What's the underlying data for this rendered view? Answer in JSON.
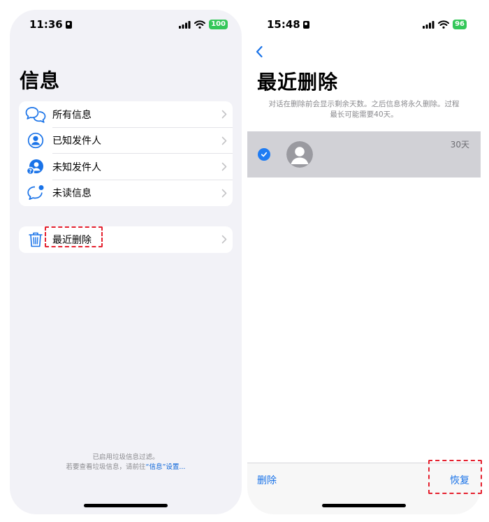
{
  "left_screen": {
    "status": {
      "time": "11:36",
      "battery": "100"
    },
    "title": "信息",
    "filters": [
      {
        "label": "所有信息"
      },
      {
        "label": "已知发件人"
      },
      {
        "label": "未知发件人"
      },
      {
        "label": "未读信息"
      }
    ],
    "recently_deleted": {
      "label": "最近删除"
    },
    "footnote": {
      "line1": "已启用垃圾信息过滤。",
      "line2_prefix": "若要查看垃圾信息，请前往",
      "line2_link": "“信息”设置...",
      "line2_suffix": ""
    }
  },
  "right_screen": {
    "status": {
      "time": "15:48",
      "battery": "96"
    },
    "title": "最近删除",
    "subtitle_line1": "对话在删除前会显示剩余天数。之后信息将永久删除。过程",
    "subtitle_line2": "最长可能需要40天。",
    "conversation": {
      "days_left": "30天",
      "selected": true
    },
    "toolbar": {
      "delete_label": "删除",
      "recover_label": "恢复"
    }
  },
  "colors": {
    "accent": "#1a73e8",
    "highlight": "#e5202e",
    "battery": "#34c759",
    "selected_row": "#d1d1d6"
  }
}
